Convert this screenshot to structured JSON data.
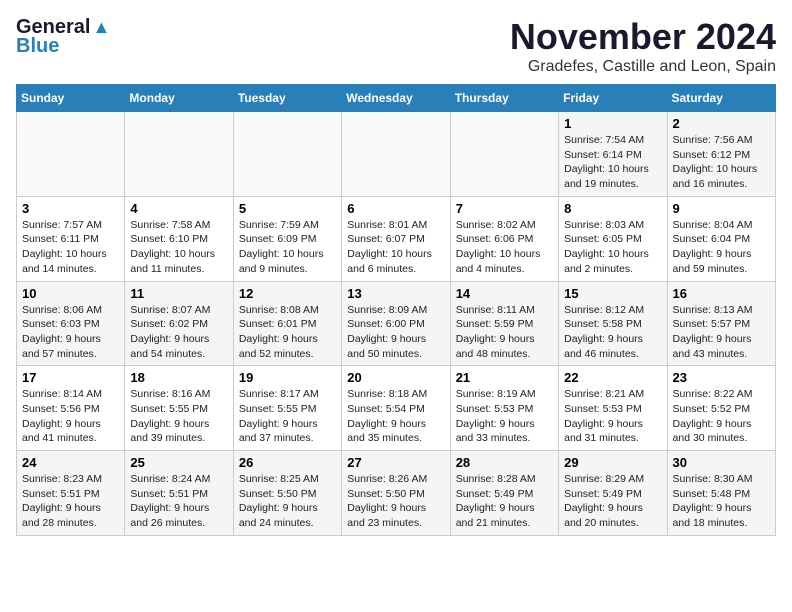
{
  "logo": {
    "general": "General",
    "blue": "Blue"
  },
  "title": "November 2024",
  "subtitle": "Gradefes, Castille and Leon, Spain",
  "headers": [
    "Sunday",
    "Monday",
    "Tuesday",
    "Wednesday",
    "Thursday",
    "Friday",
    "Saturday"
  ],
  "weeks": [
    [
      {
        "day": "",
        "info": ""
      },
      {
        "day": "",
        "info": ""
      },
      {
        "day": "",
        "info": ""
      },
      {
        "day": "",
        "info": ""
      },
      {
        "day": "",
        "info": ""
      },
      {
        "day": "1",
        "info": "Sunrise: 7:54 AM\nSunset: 6:14 PM\nDaylight: 10 hours and 19 minutes."
      },
      {
        "day": "2",
        "info": "Sunrise: 7:56 AM\nSunset: 6:12 PM\nDaylight: 10 hours and 16 minutes."
      }
    ],
    [
      {
        "day": "3",
        "info": "Sunrise: 7:57 AM\nSunset: 6:11 PM\nDaylight: 10 hours and 14 minutes."
      },
      {
        "day": "4",
        "info": "Sunrise: 7:58 AM\nSunset: 6:10 PM\nDaylight: 10 hours and 11 minutes."
      },
      {
        "day": "5",
        "info": "Sunrise: 7:59 AM\nSunset: 6:09 PM\nDaylight: 10 hours and 9 minutes."
      },
      {
        "day": "6",
        "info": "Sunrise: 8:01 AM\nSunset: 6:07 PM\nDaylight: 10 hours and 6 minutes."
      },
      {
        "day": "7",
        "info": "Sunrise: 8:02 AM\nSunset: 6:06 PM\nDaylight: 10 hours and 4 minutes."
      },
      {
        "day": "8",
        "info": "Sunrise: 8:03 AM\nSunset: 6:05 PM\nDaylight: 10 hours and 2 minutes."
      },
      {
        "day": "9",
        "info": "Sunrise: 8:04 AM\nSunset: 6:04 PM\nDaylight: 9 hours and 59 minutes."
      }
    ],
    [
      {
        "day": "10",
        "info": "Sunrise: 8:06 AM\nSunset: 6:03 PM\nDaylight: 9 hours and 57 minutes."
      },
      {
        "day": "11",
        "info": "Sunrise: 8:07 AM\nSunset: 6:02 PM\nDaylight: 9 hours and 54 minutes."
      },
      {
        "day": "12",
        "info": "Sunrise: 8:08 AM\nSunset: 6:01 PM\nDaylight: 9 hours and 52 minutes."
      },
      {
        "day": "13",
        "info": "Sunrise: 8:09 AM\nSunset: 6:00 PM\nDaylight: 9 hours and 50 minutes."
      },
      {
        "day": "14",
        "info": "Sunrise: 8:11 AM\nSunset: 5:59 PM\nDaylight: 9 hours and 48 minutes."
      },
      {
        "day": "15",
        "info": "Sunrise: 8:12 AM\nSunset: 5:58 PM\nDaylight: 9 hours and 46 minutes."
      },
      {
        "day": "16",
        "info": "Sunrise: 8:13 AM\nSunset: 5:57 PM\nDaylight: 9 hours and 43 minutes."
      }
    ],
    [
      {
        "day": "17",
        "info": "Sunrise: 8:14 AM\nSunset: 5:56 PM\nDaylight: 9 hours and 41 minutes."
      },
      {
        "day": "18",
        "info": "Sunrise: 8:16 AM\nSunset: 5:55 PM\nDaylight: 9 hours and 39 minutes."
      },
      {
        "day": "19",
        "info": "Sunrise: 8:17 AM\nSunset: 5:55 PM\nDaylight: 9 hours and 37 minutes."
      },
      {
        "day": "20",
        "info": "Sunrise: 8:18 AM\nSunset: 5:54 PM\nDaylight: 9 hours and 35 minutes."
      },
      {
        "day": "21",
        "info": "Sunrise: 8:19 AM\nSunset: 5:53 PM\nDaylight: 9 hours and 33 minutes."
      },
      {
        "day": "22",
        "info": "Sunrise: 8:21 AM\nSunset: 5:53 PM\nDaylight: 9 hours and 31 minutes."
      },
      {
        "day": "23",
        "info": "Sunrise: 8:22 AM\nSunset: 5:52 PM\nDaylight: 9 hours and 30 minutes."
      }
    ],
    [
      {
        "day": "24",
        "info": "Sunrise: 8:23 AM\nSunset: 5:51 PM\nDaylight: 9 hours and 28 minutes."
      },
      {
        "day": "25",
        "info": "Sunrise: 8:24 AM\nSunset: 5:51 PM\nDaylight: 9 hours and 26 minutes."
      },
      {
        "day": "26",
        "info": "Sunrise: 8:25 AM\nSunset: 5:50 PM\nDaylight: 9 hours and 24 minutes."
      },
      {
        "day": "27",
        "info": "Sunrise: 8:26 AM\nSunset: 5:50 PM\nDaylight: 9 hours and 23 minutes."
      },
      {
        "day": "28",
        "info": "Sunrise: 8:28 AM\nSunset: 5:49 PM\nDaylight: 9 hours and 21 minutes."
      },
      {
        "day": "29",
        "info": "Sunrise: 8:29 AM\nSunset: 5:49 PM\nDaylight: 9 hours and 20 minutes."
      },
      {
        "day": "30",
        "info": "Sunrise: 8:30 AM\nSunset: 5:48 PM\nDaylight: 9 hours and 18 minutes."
      }
    ]
  ]
}
